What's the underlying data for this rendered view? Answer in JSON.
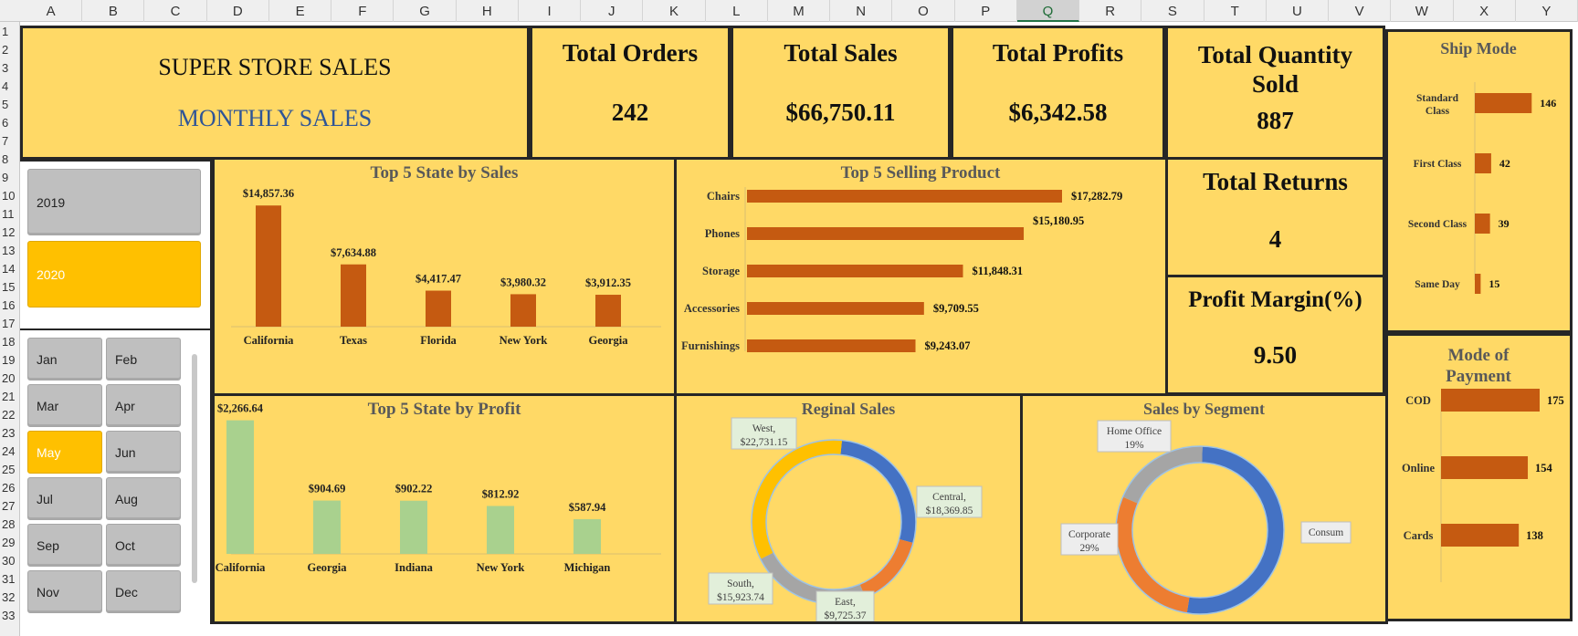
{
  "columns": [
    "A",
    "B",
    "C",
    "D",
    "E",
    "F",
    "G",
    "H",
    "I",
    "J",
    "K",
    "L",
    "M",
    "N",
    "O",
    "P",
    "Q",
    "R",
    "S",
    "T",
    "U",
    "V",
    "W",
    "X",
    "Y"
  ],
  "selected_column": "Q",
  "rows": [
    "1",
    "2",
    "3",
    "4",
    "5",
    "6",
    "7",
    "8",
    "9",
    "10",
    "11",
    "12",
    "13",
    "14",
    "15",
    "16",
    "17",
    "18",
    "19",
    "20",
    "21",
    "22",
    "23",
    "24",
    "25",
    "26",
    "27",
    "28",
    "29",
    "30",
    "31",
    "32",
    "33"
  ],
  "header": {
    "title": "SUPER STORE SALES",
    "subtitle": "MONTHLY SALES"
  },
  "kpis": {
    "total_orders": {
      "label": "Total Orders",
      "value": "242"
    },
    "total_sales": {
      "label": "Total Sales",
      "value": "$66,750.11"
    },
    "total_profits": {
      "label": "Total Profits",
      "value": "$6,342.58"
    },
    "total_quantity": {
      "label_line1": "Total Quantity",
      "label_line2": "Sold",
      "value": "887"
    },
    "total_returns": {
      "label": "Total Returns",
      "value": "4"
    },
    "profit_margin": {
      "label": "Profit Margin(%)",
      "value": "9.50"
    }
  },
  "year_slicer": {
    "items": [
      {
        "label": "2019",
        "selected": false
      },
      {
        "label": "2020",
        "selected": true
      }
    ]
  },
  "month_slicer": {
    "items": [
      {
        "label": "Jan",
        "selected": false
      },
      {
        "label": "Feb",
        "selected": false
      },
      {
        "label": "Mar",
        "selected": false
      },
      {
        "label": "Apr",
        "selected": false
      },
      {
        "label": "May",
        "selected": true
      },
      {
        "label": "Jun",
        "selected": false
      },
      {
        "label": "Jul",
        "selected": false
      },
      {
        "label": "Aug",
        "selected": false
      },
      {
        "label": "Sep",
        "selected": false
      },
      {
        "label": "Oct",
        "selected": false
      },
      {
        "label": "Nov",
        "selected": false
      },
      {
        "label": "Dec",
        "selected": false
      }
    ]
  },
  "colors": {
    "panel": "#ffd966",
    "bar_orange": "#c55a11",
    "bar_green": "#a9d18e",
    "selected": "#ffc000",
    "border": "#262626",
    "blue": "#4472c4",
    "gray": "#a5a5a5",
    "orange": "#ed7d31",
    "gold": "#ffc000"
  },
  "chart_data": [
    {
      "id": "state_sales",
      "type": "bar",
      "title": "Top 5 State by Sales",
      "categories": [
        "California",
        "Texas",
        "Florida",
        "New York",
        "Georgia"
      ],
      "values": [
        14857.36,
        7634.88,
        4417.47,
        3980.32,
        3912.35
      ],
      "labels": [
        "$14,857.36",
        "$7,634.88",
        "$4,417.47",
        "$3,980.32",
        "$3,912.35"
      ],
      "ylim": [
        0,
        16000
      ]
    },
    {
      "id": "state_profit",
      "type": "bar",
      "title": "Top 5 State by Profit",
      "categories": [
        "California",
        "Georgia",
        "Indiana",
        "New York",
        "Michigan"
      ],
      "values": [
        2266.64,
        904.69,
        902.22,
        812.92,
        587.94
      ],
      "labels": [
        "$2,266.64",
        "$904.69",
        "$902.22",
        "$812.92",
        "$587.94"
      ],
      "ylim": [
        0,
        2400
      ]
    },
    {
      "id": "product",
      "type": "bar",
      "orientation": "horizontal",
      "title": "Top 5 Selling Product",
      "categories": [
        "Chairs",
        "Phones",
        "Storage",
        "Accessories",
        "Furnishings"
      ],
      "values": [
        17282.79,
        15180.95,
        11848.31,
        9709.55,
        9243.07
      ],
      "labels": [
        "$17,282.79",
        "$15,180.95",
        "$11,848.31",
        "$9,709.55",
        "$9,243.07"
      ],
      "xlim": [
        0,
        18000
      ]
    },
    {
      "id": "ship_mode",
      "type": "bar",
      "orientation": "horizontal",
      "title": "Ship Mode",
      "categories": [
        "Standard Class",
        "First Class",
        "Second Class",
        "Same Day"
      ],
      "values": [
        146,
        42,
        39,
        15
      ],
      "xlim": [
        0,
        150
      ]
    },
    {
      "id": "payment",
      "type": "bar",
      "orientation": "horizontal",
      "title_line1": "Mode of",
      "title_line2": "Payment",
      "categories": [
        "COD",
        "Online",
        "Cards"
      ],
      "values": [
        175,
        154,
        138
      ],
      "xlim": [
        0,
        180
      ]
    },
    {
      "id": "region",
      "type": "pie",
      "title": "Reginal Sales",
      "slices": [
        {
          "name": "Central",
          "value": 18369.85,
          "label": "$18,369.85",
          "color": "#4472c4"
        },
        {
          "name": "East",
          "value": 9725.37,
          "label": "$9,725.37",
          "color": "#ed7d31"
        },
        {
          "name": "South",
          "value": 15923.74,
          "label": "$15,923.74",
          "color": "#a5a5a5"
        },
        {
          "name": "West",
          "value": 22731.15,
          "label": "$22,731.15",
          "color": "#ffc000"
        }
      ]
    },
    {
      "id": "segment",
      "type": "pie",
      "title": "Sales by Segment",
      "slices": [
        {
          "name": "Consum",
          "value": 52,
          "label": "",
          "color": "#4472c4"
        },
        {
          "name": "Corporate",
          "value": 29,
          "label": "29%",
          "color": "#ed7d31"
        },
        {
          "name": "Home Office",
          "value": 19,
          "label": "19%",
          "color": "#a5a5a5"
        }
      ]
    }
  ]
}
